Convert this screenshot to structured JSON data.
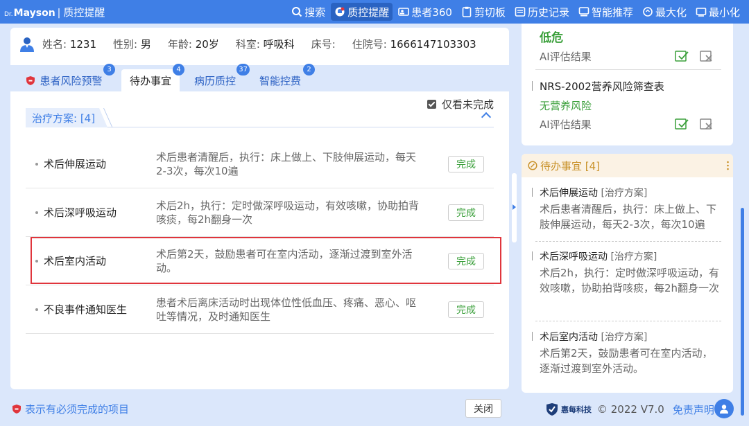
{
  "titlebar": {
    "logo_dr": "Dr.",
    "logo_brand": "Mayson",
    "logo_sep": "|",
    "app_title": "质控提醒",
    "tools": [
      {
        "label": "搜索",
        "icon": "search-icon"
      },
      {
        "label": "质控提醒",
        "icon": "bell-icon",
        "active": true
      },
      {
        "label": "患者360",
        "icon": "patient-card-icon"
      },
      {
        "label": "剪切板",
        "icon": "clipboard-icon"
      },
      {
        "label": "历史记录",
        "icon": "history-icon"
      },
      {
        "label": "智能推荐",
        "icon": "recommend-icon"
      },
      {
        "label": "最大化",
        "icon": "maximize-icon"
      },
      {
        "label": "最小化",
        "icon": "minimize-icon"
      }
    ]
  },
  "patient": {
    "name_label": "姓名:",
    "name": "1231",
    "gender_label": "性别:",
    "gender": "男",
    "age_label": "年龄:",
    "age": "20岁",
    "dept_label": "科室:",
    "dept": "呼吸科",
    "bed_label": "床号:",
    "bed": "",
    "admission_label": "住院号:",
    "admission": "1666147103303"
  },
  "tabs": [
    {
      "label": "患者风险预警",
      "badge": "3"
    },
    {
      "label": "待办事宜",
      "badge": "4",
      "active": true
    },
    {
      "label": "病历质控",
      "badge": "37"
    },
    {
      "label": "智能控费",
      "badge": "2"
    }
  ],
  "filter": {
    "only_unfinished": "仅看未完成",
    "checked": true
  },
  "plan": {
    "header": "治疗方案: [4]",
    "items": [
      {
        "name": "术后伸展运动",
        "desc": "术后患者清醒后，执行：床上做上、下肢伸展运动，每天2-3次，每次10遍",
        "action": "完成"
      },
      {
        "name": "术后深呼吸运动",
        "desc": "术后2h，执行：定时做深呼吸运动，有效咳嗽，协助拍背咳痰，每2h翻身一次",
        "action": "完成"
      },
      {
        "name": "术后室内活动",
        "desc": "术后第2天，鼓励患者可在室内活动，逐渐过渡到室外活动。",
        "action": "完成"
      },
      {
        "name": "不良事件通知医生",
        "desc": "患者术后离床活动时出现体位性低血压、疼痛、恶心、呕吐等情况，及时通知医生",
        "action": "完成"
      }
    ]
  },
  "footer": {
    "note": "表示有必须完成的项目",
    "close": "关闭",
    "brand": "惠每科技",
    "copyright": "© 2022 V7.0",
    "disclaimer": "免责声明"
  },
  "risk_panel": {
    "level": "低危",
    "ai_result_1": "AI评估结果",
    "nrs_title": "NRS-2002营养风险筛查表",
    "nrs_value": "无营养风险",
    "ai_result_2": "AI评估结果"
  },
  "todo_panel": {
    "header": "待办事宜 [4]",
    "items": [
      {
        "name": "术后伸展运动",
        "category": "[治疗方案]",
        "desc": "术后患者清醒后，执行：床上做上、下肢伸展运动，每天2-3次，每次10遍"
      },
      {
        "name": "术后深呼吸运动",
        "category": "[治疗方案]",
        "desc": "术后2h，执行：定时做深呼吸运动，有效咳嗽，协助拍背咳痰，每2h翻身一次"
      },
      {
        "name": "术后室内活动",
        "category": "[治疗方案]",
        "desc": "术后第2天，鼓励患者可在室内活动，逐渐过渡到室外活动。"
      }
    ]
  },
  "colors": {
    "primary": "#3f7fe6",
    "success": "#3a9f3a",
    "warning": "#c9922a",
    "highlight": "#e0353c"
  }
}
